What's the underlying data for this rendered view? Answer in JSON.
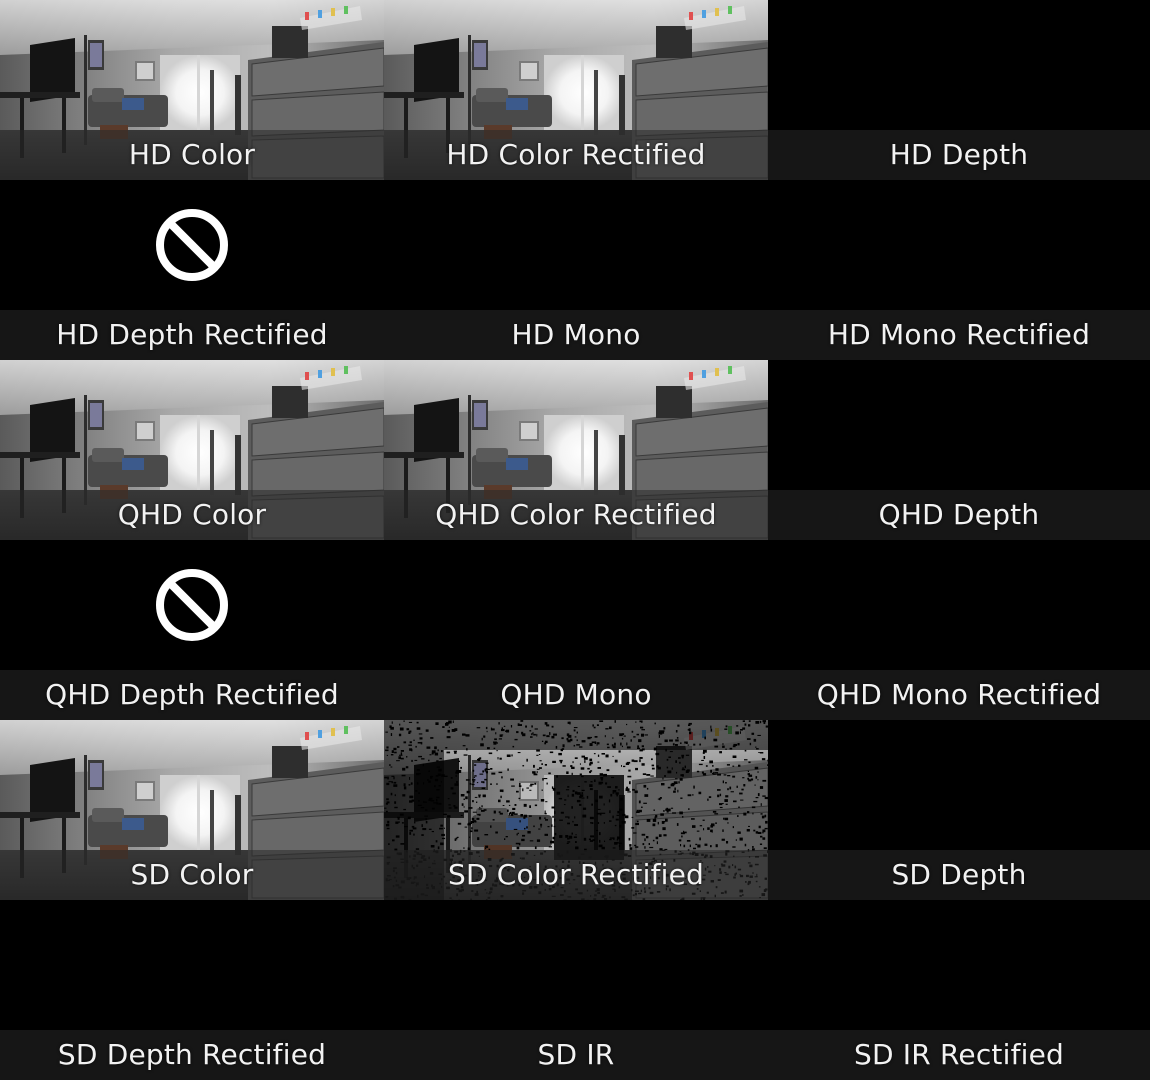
{
  "colors": {
    "background": "#000000",
    "caption_bar": "#282828",
    "caption_text": "#f2f2f2"
  },
  "tiles": [
    {
      "label": "HD Color",
      "content": "room-camera-image"
    },
    {
      "label": "HD Color Rectified",
      "content": "room-camera-image"
    },
    {
      "label": "HD Depth",
      "content": "empty"
    },
    {
      "label": "HD Depth Rectified",
      "content": "blocked-icon"
    },
    {
      "label": "HD Mono",
      "content": "empty"
    },
    {
      "label": "HD Mono Rectified",
      "content": "empty"
    },
    {
      "label": "QHD Color",
      "content": "room-camera-image"
    },
    {
      "label": "QHD Color Rectified",
      "content": "room-camera-image"
    },
    {
      "label": "QHD Depth",
      "content": "empty"
    },
    {
      "label": "QHD Depth Rectified",
      "content": "blocked-icon"
    },
    {
      "label": "QHD Mono",
      "content": "empty"
    },
    {
      "label": "QHD Mono Rectified",
      "content": "empty"
    },
    {
      "label": "SD Color",
      "content": "room-camera-image"
    },
    {
      "label": "SD Color Rectified",
      "content": "registered-depth-color-image"
    },
    {
      "label": "SD Depth",
      "content": "empty"
    },
    {
      "label": "SD Depth Rectified",
      "content": "empty"
    },
    {
      "label": "SD IR",
      "content": "empty"
    },
    {
      "label": "SD IR Rectified",
      "content": "empty"
    }
  ]
}
